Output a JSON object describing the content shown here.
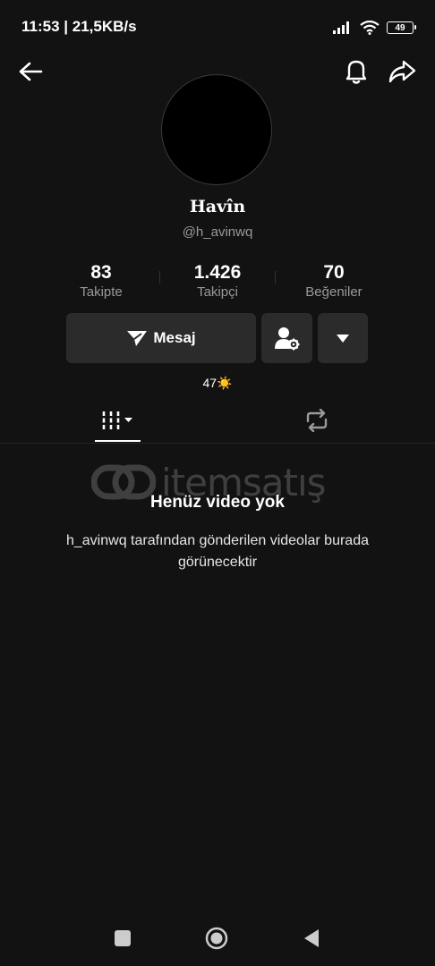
{
  "status_bar": {
    "time_speed": "11:53 | 21,5KB/s",
    "battery": "49"
  },
  "header": {
    "back_icon": "arrow-left-icon",
    "bell_icon": "bell-icon",
    "share_icon": "share-icon"
  },
  "profile": {
    "display_name": "Havîn",
    "username": "@h_avinwq",
    "bio": "47☀️"
  },
  "stats": [
    {
      "value": "83",
      "label": "Takipte"
    },
    {
      "value": "1.426",
      "label": "Takipçi"
    },
    {
      "value": "70",
      "label": "Beğeniler"
    }
  ],
  "actions": {
    "message_label": "Mesaj"
  },
  "watermark": {
    "text": "itemsatış"
  },
  "empty_state": {
    "title": "Henüz video yok",
    "description": "h_avinwq tarafından gönderilen videolar burada görünecektir"
  },
  "colors": {
    "background": "#121212",
    "button": "#2b2b2b",
    "muted_text": "#9a9a9a"
  }
}
